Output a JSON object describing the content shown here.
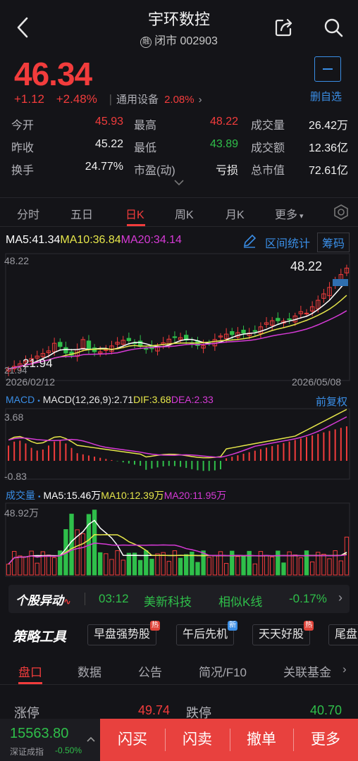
{
  "header": {
    "title": "宇环数控",
    "margin_tag": "融",
    "subtitle": "闭市 002903"
  },
  "quote": {
    "price": "46.34",
    "change": "+1.12",
    "change_pct": "+2.48%",
    "sector": "通用设备",
    "sector_pct": "2.08%",
    "watch_label": "删自选"
  },
  "stats": {
    "open_label": "今开",
    "open": "45.93",
    "high_label": "最高",
    "high": "48.22",
    "volume_label": "成交量",
    "volume": "26.42万",
    "prev_label": "昨收",
    "prev": "45.22",
    "low_label": "最低",
    "low": "43.89",
    "amount_label": "成交额",
    "amount": "12.36亿",
    "turnover_label": "换手",
    "turnover": "24.77%",
    "pe_label": "市盈(动)",
    "pe": "亏损",
    "mcap_label": "总市值",
    "mcap": "72.61亿"
  },
  "period_tabs": [
    "分时",
    "五日",
    "日K",
    "周K",
    "月K",
    "更多"
  ],
  "kline": {
    "ma5": "MA5:41.34",
    "ma10": "MA10:36.84",
    "ma20": "MA20:34.14",
    "range_stats": "区间统计",
    "chips": "筹码",
    "top_value": "48.22",
    "high_marker": "48.22",
    "low_marker": "21.94",
    "bottom_value": "21.94",
    "start_date": "2026/02/12",
    "end_date": "2026/05/08"
  },
  "macd": {
    "label": "MACD",
    "params": "MACD(12,26,9):2.71",
    "dif": "DIF:3.68",
    "dea": "DEA:2.33",
    "adjust": "前复权",
    "top_value": "3.68",
    "bottom_value": "-0.83"
  },
  "volume_panel": {
    "label": "成交量",
    "ma5": "MA5:15.46万",
    "ma10": "MA10:12.39万",
    "ma20": "MA20:11.95万",
    "top_value": "48.92万"
  },
  "alert": {
    "brand": "个股异动",
    "time": "03:12",
    "company": "美新科技",
    "tag": "相似K线",
    "pct": "-0.17%"
  },
  "strategy": {
    "title": "策略工具",
    "chips": [
      {
        "label": "早盘强势股",
        "badge": "热"
      },
      {
        "label": "午后先机",
        "badge": "新"
      },
      {
        "label": "天天好股",
        "badge": "热"
      },
      {
        "label": "尾盘",
        "badge": ""
      }
    ]
  },
  "info_tabs": [
    "盘口",
    "数据",
    "公告",
    "简况/F10",
    "关联基金"
  ],
  "limits": {
    "up_label": "涨停",
    "up": "49.74",
    "down_label": "跌停",
    "down": "40.70"
  },
  "bottom": {
    "index_value": "15563.80",
    "index_name": "深证成指",
    "index_pct": "-0.50%",
    "actions": [
      "闪买",
      "闪卖",
      "撤单",
      "更多"
    ]
  },
  "colors": {
    "up": "#f23c3c",
    "down": "#2fbf4a",
    "accent": "#3a8ee6",
    "ma5": "#ffffff",
    "ma10": "#e6e64a",
    "ma20": "#d63ad6"
  }
}
